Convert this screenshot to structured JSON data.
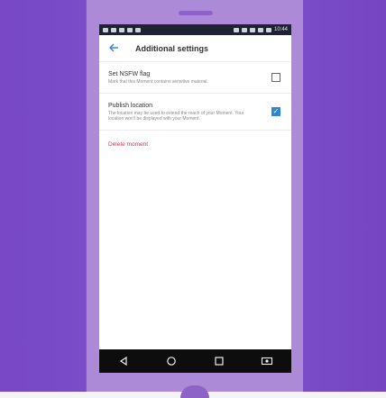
{
  "statusbar": {
    "time": "10:44"
  },
  "appbar": {
    "title": "Additional settings"
  },
  "settings": [
    {
      "title": "Set NSFW flag",
      "description": "Mark that this Moment contains sensitive material.",
      "checked": false
    },
    {
      "title": "Publish location",
      "description": "The location may be used to extend the reach of your Moment. Your location won't be displayed with your Moment.",
      "checked": true
    }
  ],
  "actions": {
    "delete_label": "Delete moment"
  },
  "colors": {
    "accent": "#2e86d6",
    "danger": "#d7354e",
    "statusbar": "#1f2233",
    "navbar": "#0d0d0d",
    "frame": "#ac8ad8",
    "background": "#7848c6"
  },
  "icons": {
    "back": "back-arrow-icon",
    "nav": [
      "nav-back-icon",
      "nav-home-icon",
      "nav-recents-icon",
      "nav-extra-icon"
    ]
  }
}
